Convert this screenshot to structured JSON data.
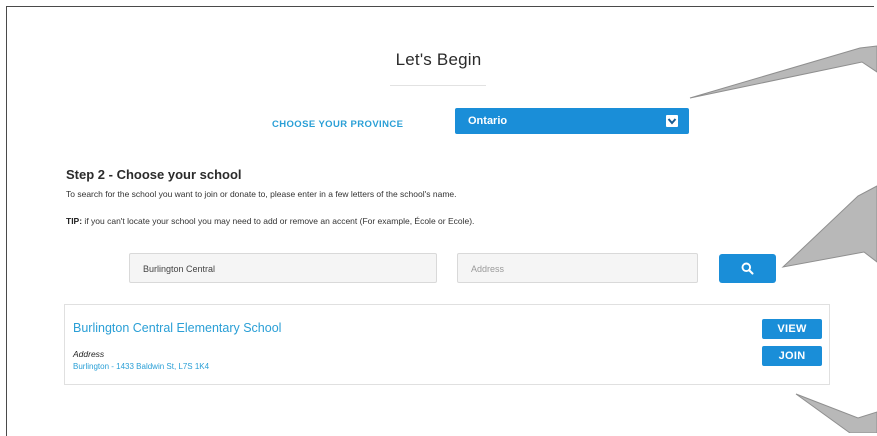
{
  "page": {
    "heading": "Let's Begin"
  },
  "province": {
    "label": "CHOOSE YOUR PROVINCE",
    "selected": "Ontario"
  },
  "step": {
    "title": "Step 2 - Choose your school",
    "instructions": "To search for the school you want to join or donate to, please enter in a few letters of the school's name.",
    "tip_label": "TIP:",
    "tip_text": " if you can't locate your school you may need to add or remove an accent (For example, École or Ecole)."
  },
  "search": {
    "school_value": "Burlington Central",
    "address_placeholder": "Address",
    "button_icon": "search-icon"
  },
  "result": {
    "name": "Burlington Central Elementary School",
    "address_label": "Address",
    "address_value": "Burlington - 1433 Baldwin St, L7S 1K4",
    "view_label": "VIEW",
    "join_label": "JOIN"
  },
  "colors": {
    "accent": "#1a8ed8",
    "link": "#2a9fd6",
    "callout": "#b5b5b5"
  }
}
